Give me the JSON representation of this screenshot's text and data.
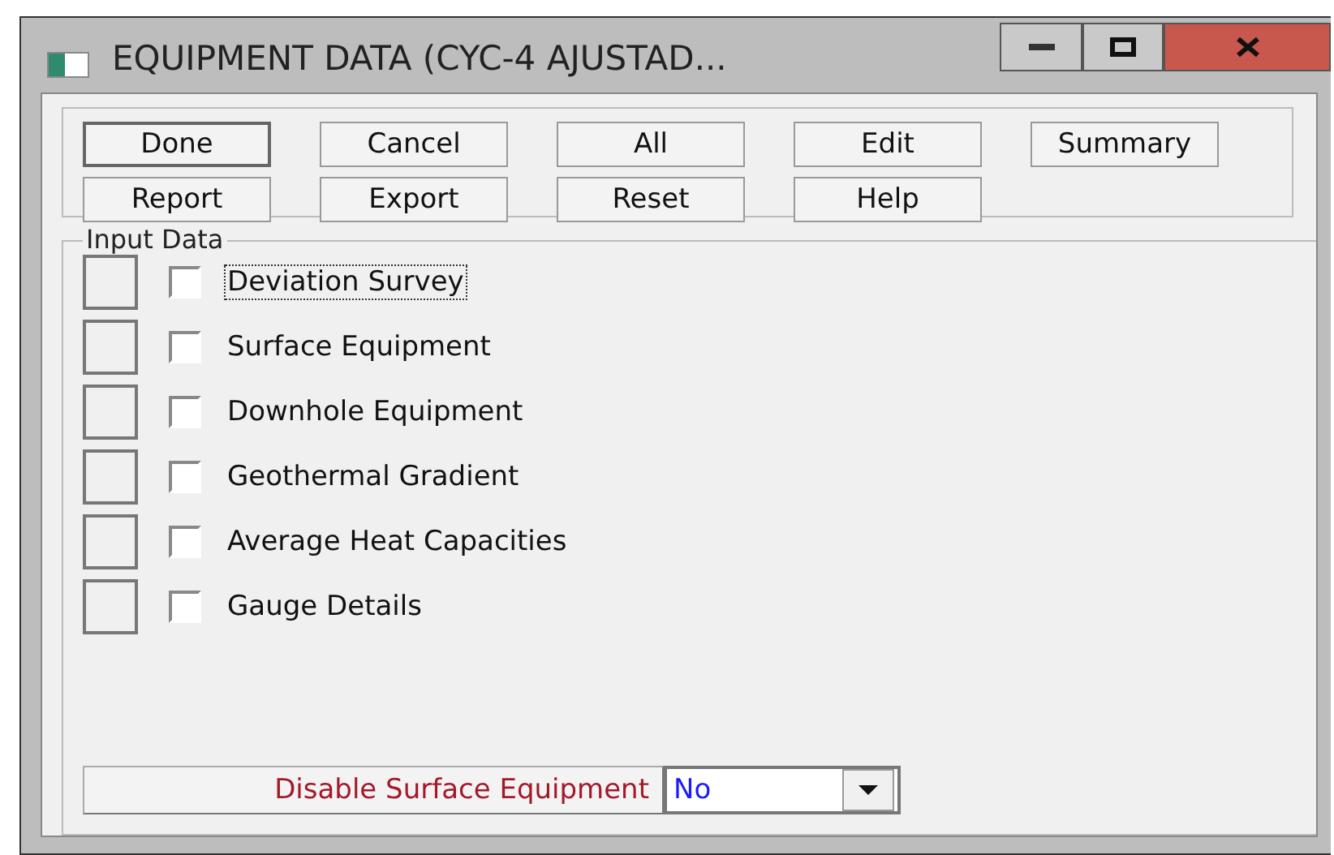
{
  "window": {
    "title": "EQUIPMENT DATA (CYC-4 AJUSTAD..."
  },
  "buttons": [
    {
      "label": "Done",
      "default": true
    },
    {
      "label": "Cancel",
      "default": false
    },
    {
      "label": "All",
      "default": false
    },
    {
      "label": "Edit",
      "default": false
    },
    {
      "label": "Summary",
      "default": false
    },
    {
      "label": "Report",
      "default": false
    },
    {
      "label": "Export",
      "default": false
    },
    {
      "label": "Reset",
      "default": false
    },
    {
      "label": "Help",
      "default": false
    }
  ],
  "input_data": {
    "title": "Input Data",
    "items": [
      {
        "label": "Deviation Survey",
        "checked": false,
        "focused": true
      },
      {
        "label": "Surface Equipment",
        "checked": false,
        "focused": false
      },
      {
        "label": "Downhole Equipment",
        "checked": false,
        "focused": false
      },
      {
        "label": "Geothermal Gradient",
        "checked": false,
        "focused": false
      },
      {
        "label": "Average Heat Capacities",
        "checked": false,
        "focused": false
      },
      {
        "label": "Gauge Details",
        "checked": false,
        "focused": false
      }
    ]
  },
  "disable_surface_equipment": {
    "label": "Disable Surface Equipment",
    "value": "No"
  }
}
